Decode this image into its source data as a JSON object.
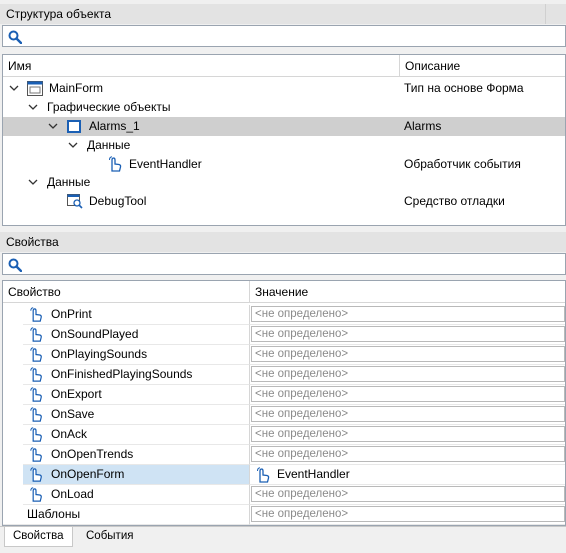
{
  "structure_panel": {
    "title": "Структура объекта",
    "search_placeholder": "",
    "columns": {
      "name": "Имя",
      "description": "Описание"
    },
    "nodes": [
      {
        "label": "MainForm",
        "description": "Тип на основе Форма"
      },
      {
        "label": "Графические объекты",
        "description": ""
      },
      {
        "label": "Alarms_1",
        "description": "Alarms"
      },
      {
        "label": "Данные",
        "description": ""
      },
      {
        "label": "EventHandler",
        "description": "Обработчик события"
      },
      {
        "label": "Данные",
        "description": ""
      },
      {
        "label": "DebugTool",
        "description": "Средство отладки"
      }
    ]
  },
  "properties_panel": {
    "title": "Свойства",
    "search_placeholder": "",
    "columns": {
      "property": "Свойство",
      "value": "Значение"
    },
    "undefined_text": "<не определено>",
    "rows": [
      {
        "name": "OnPrint",
        "value": "<не определено>"
      },
      {
        "name": "OnSoundPlayed",
        "value": "<не определено>"
      },
      {
        "name": "OnPlayingSounds",
        "value": "<не определено>"
      },
      {
        "name": "OnFinishedPlayingSounds",
        "value": "<не определено>"
      },
      {
        "name": "OnExport",
        "value": "<не определено>"
      },
      {
        "name": "OnSave",
        "value": "<не определено>"
      },
      {
        "name": "OnAck",
        "value": "<не определено>"
      },
      {
        "name": "OnOpenTrends",
        "value": "<не определено>"
      },
      {
        "name": "OnOpenForm",
        "value": "EventHandler"
      },
      {
        "name": "OnLoad",
        "value": "<не определено>"
      },
      {
        "name": "Шаблоны",
        "value": "<не определено>"
      }
    ]
  },
  "tabs": [
    {
      "label": "Свойства",
      "active": true
    },
    {
      "label": "События",
      "active": false
    }
  ],
  "colors": {
    "selected_row": "#cfe3f4",
    "tree_selected": "#cfcfcf",
    "icon_blue": "#1a5fb4"
  }
}
